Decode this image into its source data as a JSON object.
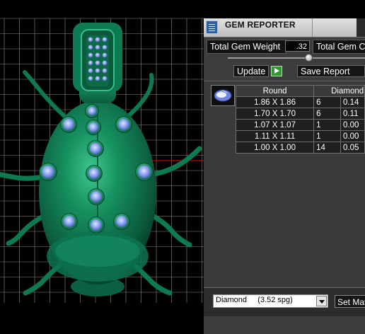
{
  "viewport": {
    "background": "#000000",
    "grid_color": "#8a8a8a",
    "model_color": "#0f7a55",
    "gem_color": "#7e97e8",
    "axis_color": "#cc0000"
  },
  "panel": {
    "title": "GEM REPORTER",
    "title_icon": "report-icon",
    "total_gem_weight_label": "Total Gem Weight",
    "total_gem_weight_value": ".32",
    "total_gem_count_label": "Total Gem Count",
    "update_label": "Update",
    "save_report_label": "Save Report",
    "gem_shape_icon": "round-gem-icon",
    "table": {
      "headers": [
        "Round",
        "Diamond"
      ],
      "rows": [
        {
          "size": "1.86 X 1.86",
          "count": "6",
          "weight": "0.14"
        },
        {
          "size": "1.70 X 1.70",
          "count": "6",
          "weight": "0.11"
        },
        {
          "size": "1.07 X 1.07",
          "count": "1",
          "weight": "0.00"
        },
        {
          "size": "1.11 X 1.11",
          "count": "1",
          "weight": "0.00"
        },
        {
          "size": "1.00 X 1.00",
          "count": "14",
          "weight": "0.05"
        }
      ]
    },
    "material_select": {
      "value": "Diamond     (3.52 spg)"
    },
    "set_material_label": "Set Material"
  }
}
